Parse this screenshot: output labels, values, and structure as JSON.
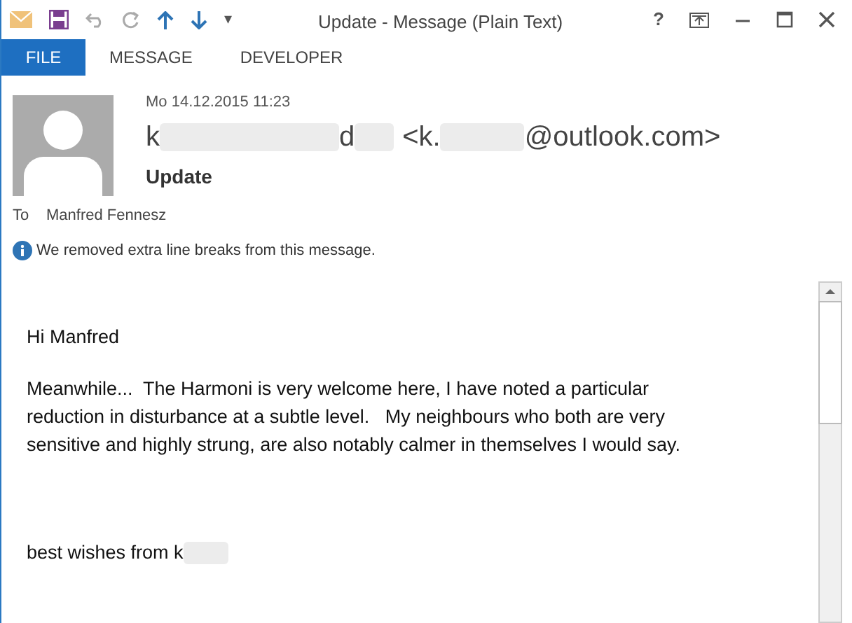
{
  "window": {
    "title": "Update - Message (Plain Text)"
  },
  "ribbon_tabs": [
    {
      "label": "FILE",
      "selected": true
    },
    {
      "label": "MESSAGE",
      "selected": false
    },
    {
      "label": "DEVELOPER",
      "selected": false
    }
  ],
  "quick_access": [
    "▾"
  ],
  "window_controls": [
    "?"
  ],
  "header": {
    "date": "Mo 14.12.2015 11:23",
    "sender": [
      {
        "kind": "text",
        "text": "k"
      },
      {
        "kind": "redacted"
      },
      {
        "kind": "text",
        "text": "d"
      },
      {
        "kind": "redacted"
      },
      {
        "kind": "text",
        "text": "<k."
      },
      {
        "kind": "redacted"
      },
      {
        "kind": "text",
        "text": "@outlook.com>"
      }
    ],
    "subject": "Update",
    "to_label": "To",
    "to": "Manfred Fennesz",
    "info": "We removed extra line breaks from this message."
  },
  "body": [
    {
      "lines": [
        "Hi Manfred"
      ]
    },
    {
      "lines": [
        "Meanwhile...  The Harmoni is very welcome here, I have noted a particular",
        "reduction in disturbance at a subtle level.   My neighbours who both are very",
        "sensitive and highly strung, are also notably calmer in themselves I would say."
      ]
    },
    {
      "lines": [
        "best wishes from k"
      ],
      "redacted_tail": true
    }
  ]
}
